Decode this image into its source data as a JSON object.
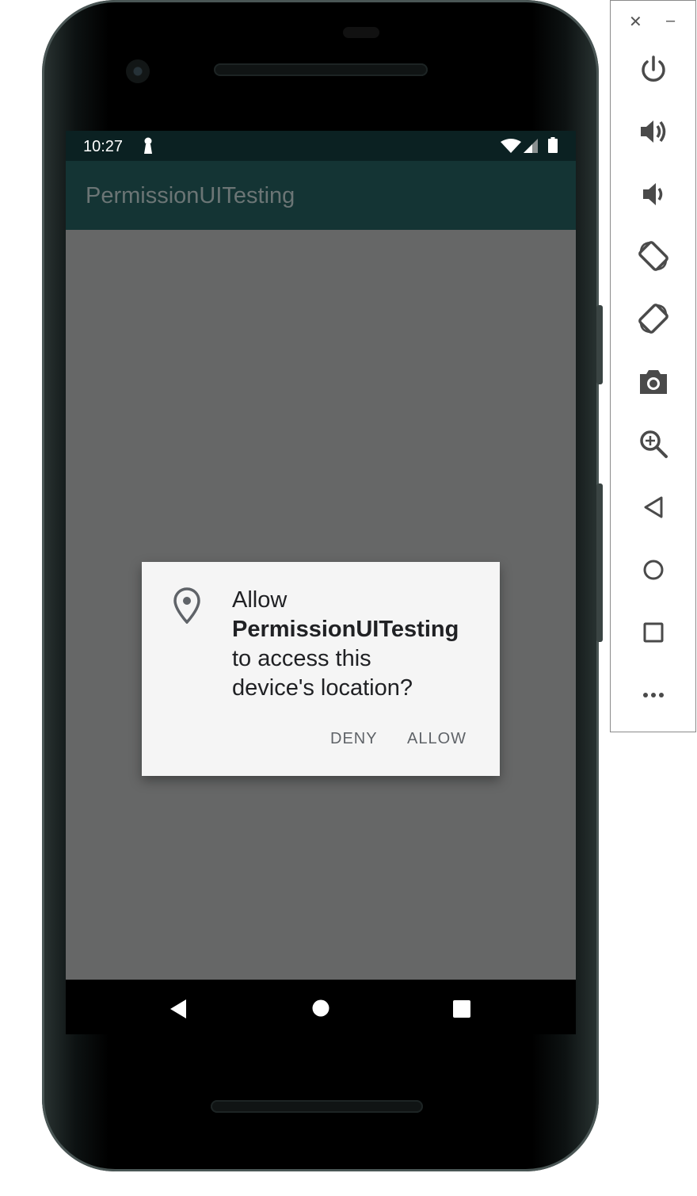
{
  "status_bar": {
    "time": "10:27"
  },
  "app_bar": {
    "title": "PermissionUITesting"
  },
  "dialog": {
    "line1": "Allow",
    "app_name": "PermissionUITesting",
    "line3": "to access this",
    "line4": "device's location?",
    "deny_label": "DENY",
    "allow_label": "ALLOW",
    "icon": "location-pin-icon"
  },
  "emulator_toolbar": {
    "window_controls": {
      "close": "✕",
      "minimize": "–"
    },
    "items": [
      "power-icon",
      "volume-up-icon",
      "volume-down-icon",
      "rotate-left-icon",
      "rotate-right-icon",
      "screenshot-icon",
      "zoom-icon",
      "back-icon",
      "home-icon",
      "overview-icon",
      "more-icon"
    ]
  },
  "navigation": {
    "items": [
      "back-icon",
      "home-icon",
      "recents-icon"
    ]
  },
  "colors": {
    "status_bar": "#0b2122",
    "app_bar": "#143434",
    "scrim": "#666767",
    "dialog_bg": "#f5f5f5",
    "toolbar_icon": "#4a4a4a"
  }
}
